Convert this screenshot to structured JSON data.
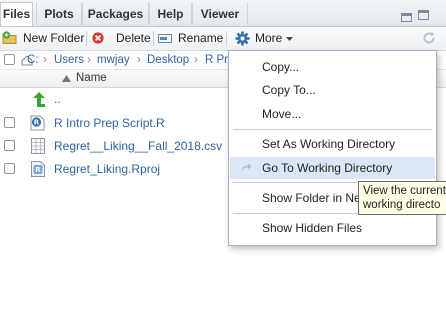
{
  "tabs": [
    {
      "label": "Files",
      "active": true
    },
    {
      "label": "Plots",
      "active": false
    },
    {
      "label": "Packages",
      "active": false
    },
    {
      "label": "Help",
      "active": false
    },
    {
      "label": "Viewer",
      "active": false
    }
  ],
  "window_controls": {
    "minimize_icon": "minimize-pane-icon",
    "maximize_icon": "maximize-pane-icon"
  },
  "toolbar": {
    "new_folder": "New Folder",
    "delete": "Delete",
    "rename": "Rename",
    "more": "More",
    "refresh_icon": "refresh-icon"
  },
  "breadcrumb": [
    "C:",
    "Users",
    "mwjay",
    "Desktop",
    "R Pra"
  ],
  "table_header": {
    "name": "Name"
  },
  "files": [
    {
      "name": "..",
      "type": "parent-dir"
    },
    {
      "name": "R Intro Prep Script.R",
      "type": "r-script"
    },
    {
      "name": "Regret__Liking__Fall_2018.csv",
      "type": "csv"
    },
    {
      "name": "Regret_Liking.Rproj",
      "type": "rproj"
    }
  ],
  "more_menu": {
    "items": [
      {
        "label": "Copy...",
        "highlighted": false
      },
      {
        "label": "Copy To...",
        "highlighted": false
      },
      {
        "label": "Move...",
        "highlighted": false
      },
      {
        "label": "Set As Working Directory",
        "highlighted": false
      },
      {
        "label": "Go To Working Directory",
        "highlighted": true
      },
      {
        "label": "Show Folder in Ne",
        "highlighted": false
      },
      {
        "label": "Show Hidden Files",
        "highlighted": false
      }
    ]
  },
  "tooltip": {
    "line1": "View the current",
    "line2": "working directo"
  },
  "colors": {
    "link": "#2f62a3",
    "highlight": "#dbe7f6",
    "tooltip_bg": "#ffffe6",
    "accent_green": "#3aa43a",
    "accent_red": "#d23b2f"
  }
}
